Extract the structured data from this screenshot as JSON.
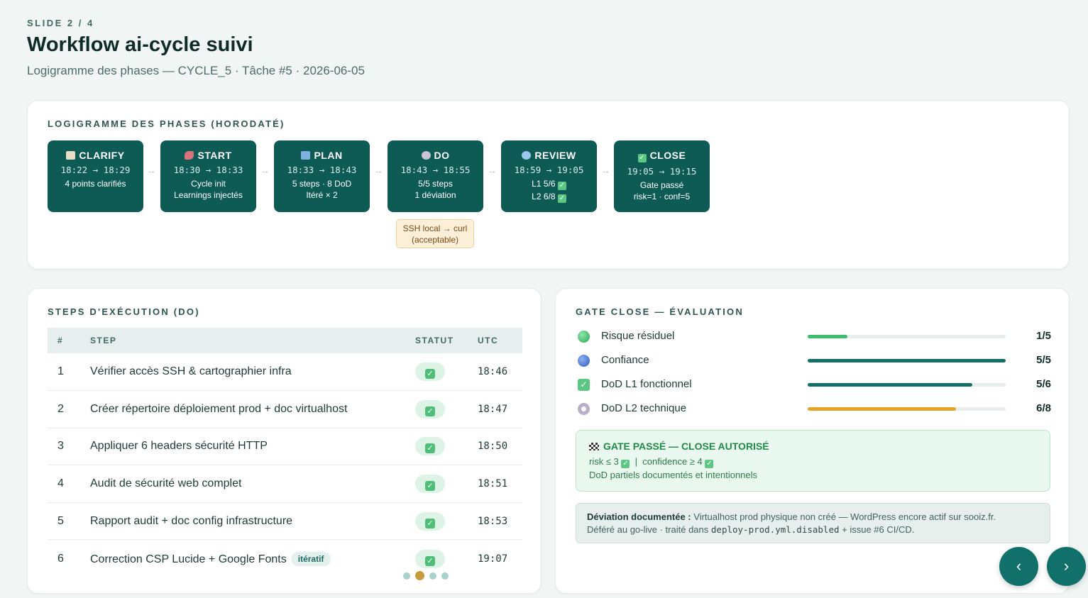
{
  "header": {
    "slide_label": "SLIDE 2 / 4",
    "title": "Workflow ai-cycle suivi",
    "subtitle": "Logigramme des phases — CYCLE_5 · Tâche #5 · 2026-06-05"
  },
  "flow": {
    "title": "LOGIGRAMME DES PHASES (HORODATÉ)",
    "arrow": "→",
    "phases": [
      {
        "name": "CLARIFY",
        "icon": "clipboard-icon",
        "time": "18:22 → 18:29",
        "line1": "4 points clarifiés",
        "line2": ""
      },
      {
        "name": "START",
        "icon": "rocket-icon",
        "time": "18:30 → 18:33",
        "line1": "Cycle init",
        "line2": "Learnings injectés"
      },
      {
        "name": "PLAN",
        "icon": "book-icon",
        "time": "18:33 → 18:43",
        "line1": "5 steps · 8 DoD",
        "line2": "Itéré × 2"
      },
      {
        "name": "DO",
        "icon": "gear-icon",
        "time": "18:43 → 18:55",
        "line1": "5/5 steps",
        "line2": "1 déviation"
      },
      {
        "name": "REVIEW",
        "icon": "magnifier-icon",
        "time": "18:59 → 19:05",
        "line1": "L1 5/6",
        "line2": "L2 6/8"
      },
      {
        "name": "CLOSE",
        "icon": "checkbox-icon",
        "time": "19:05 → 19:15",
        "line1": "Gate passé",
        "line2": "risk=1 · conf=5"
      }
    ],
    "deviation_tag": {
      "line1": "SSH local → curl",
      "line2": "(acceptable)"
    }
  },
  "steps": {
    "title": "STEPS D'EXÉCUTION (DO)",
    "headers": {
      "num": "#",
      "step": "STEP",
      "status": "STATUT",
      "utc": "UTC"
    },
    "rows": [
      {
        "num": "1",
        "step": "Vérifier accès SSH & cartographier infra",
        "badge": "",
        "utc": "18:46"
      },
      {
        "num": "2",
        "step": "Créer répertoire déploiement prod + doc virtualhost",
        "badge": "",
        "utc": "18:47"
      },
      {
        "num": "3",
        "step": "Appliquer 6 headers sécurité HTTP",
        "badge": "",
        "utc": "18:50"
      },
      {
        "num": "4",
        "step": "Audit de sécurité web complet",
        "badge": "",
        "utc": "18:51"
      },
      {
        "num": "5",
        "step": "Rapport audit + doc config infrastructure",
        "badge": "",
        "utc": "18:53"
      },
      {
        "num": "6",
        "step": "Correction CSP Lucide + Google Fonts",
        "badge": "itératif",
        "utc": "19:07"
      }
    ],
    "check_glyph": "✓"
  },
  "gate": {
    "title": "GATE CLOSE — ÉVALUATION",
    "metrics": [
      {
        "label": "Risque résiduel",
        "value": "1/5",
        "fraction": 0.2,
        "color": "#3bbf6e",
        "icon": "green-circle-icon"
      },
      {
        "label": "Confiance",
        "value": "5/5",
        "fraction": 1.0,
        "color": "#137068",
        "icon": "blue-circle-icon"
      },
      {
        "label": "DoD L1 fonctionnel",
        "value": "5/6",
        "fraction": 0.833,
        "color": "#137068",
        "icon": "check-box-icon"
      },
      {
        "label": "DoD L2 technique",
        "value": "6/8",
        "fraction": 0.75,
        "color": "#e8a428",
        "icon": "gear-icon"
      }
    ],
    "pass_box": {
      "title": "GATE PASSÉ — CLOSE AUTORISÉ",
      "risk_text": "risk ≤ 3",
      "separator": "|",
      "confidence_text": "confidence ≥ 4",
      "line2": "DoD partiels documentés et intentionnels"
    },
    "deviation": {
      "label": "Déviation documentée :",
      "text1": "Virtualhost prod physique non créé — WordPress encore actif sur sooiz.fr.",
      "text2": "Déféré au go-live · traité dans",
      "file": "deploy-prod.yml.disabled",
      "text3": "+ issue #6 CI/CD."
    }
  },
  "nav": {
    "prev": "‹",
    "next": "›"
  }
}
